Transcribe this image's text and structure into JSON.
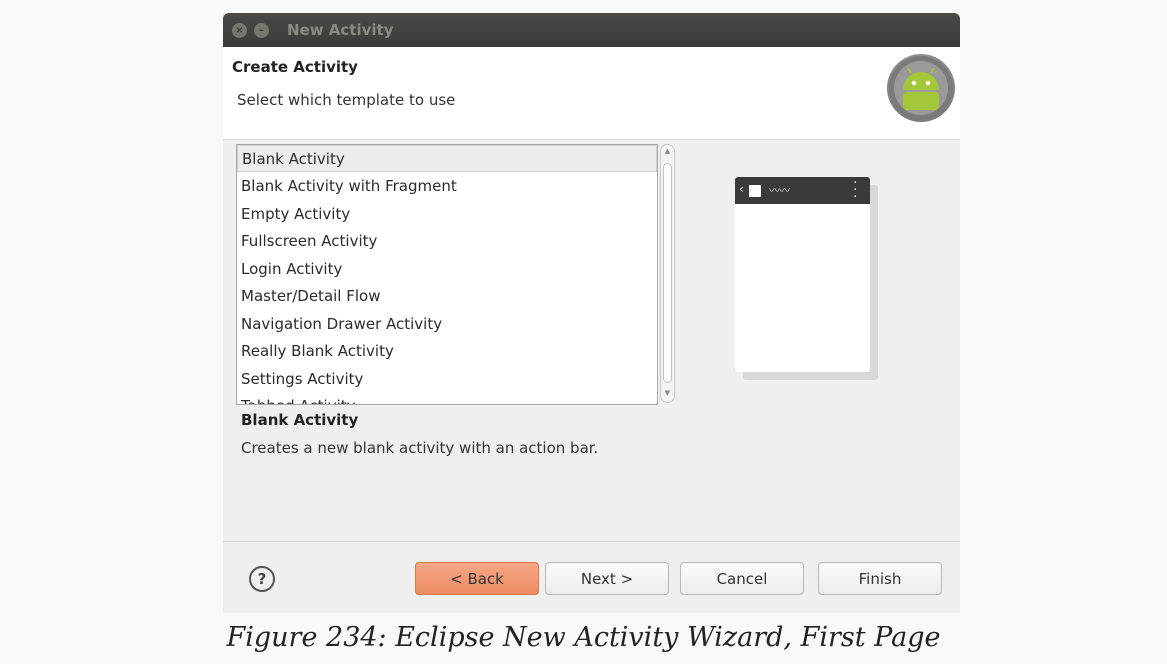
{
  "window": {
    "title": "New Activity"
  },
  "header": {
    "title": "Create Activity",
    "subtitle": "Select which template to use"
  },
  "templates": {
    "items": [
      "Blank Activity",
      "Blank Activity with Fragment",
      "Empty Activity",
      "Fullscreen Activity",
      "Login Activity",
      "Master/Detail Flow",
      "Navigation Drawer Activity",
      "Really Blank Activity",
      "Settings Activity",
      "Tabbed Activity"
    ],
    "selected": "Blank Activity"
  },
  "description": {
    "title": "Blank Activity",
    "text": "Creates a new blank activity with an action bar."
  },
  "buttons": {
    "back": "< Back",
    "next": "Next >",
    "cancel": "Cancel",
    "finish": "Finish"
  },
  "caption": "Figure 234: Eclipse New Activity Wizard, First Page",
  "icons": {
    "help": "?"
  }
}
